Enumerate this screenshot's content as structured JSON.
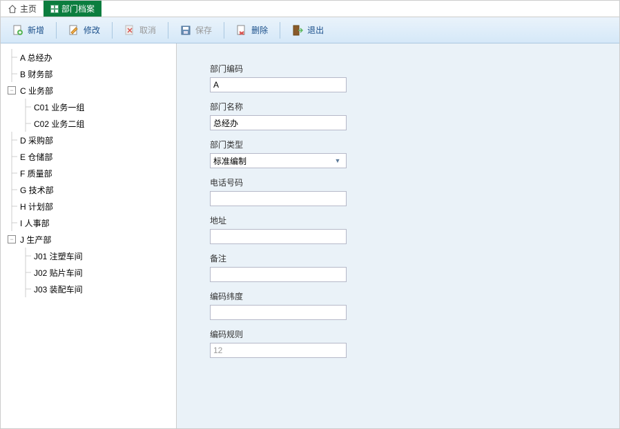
{
  "tabs": {
    "home": "主页",
    "active": "部门档案"
  },
  "toolbar": {
    "add": "新增",
    "edit": "修改",
    "cancel": "取消",
    "save": "保存",
    "delete": "删除",
    "exit": "退出"
  },
  "tree": [
    {
      "depth": 0,
      "expander": "",
      "code": "A",
      "name": "总经办"
    },
    {
      "depth": 0,
      "expander": "",
      "code": "B",
      "name": "财务部"
    },
    {
      "depth": 0,
      "expander": "-",
      "code": "C",
      "name": "业务部"
    },
    {
      "depth": 1,
      "expander": "",
      "code": "C01",
      "name": "业务一组"
    },
    {
      "depth": 1,
      "expander": "",
      "code": "C02",
      "name": "业务二组"
    },
    {
      "depth": 0,
      "expander": "",
      "code": "D",
      "name": "采购部"
    },
    {
      "depth": 0,
      "expander": "",
      "code": "E",
      "name": "仓储部"
    },
    {
      "depth": 0,
      "expander": "",
      "code": "F",
      "name": "质量部"
    },
    {
      "depth": 0,
      "expander": "",
      "code": "G",
      "name": "技术部"
    },
    {
      "depth": 0,
      "expander": "",
      "code": "H",
      "name": "计划部"
    },
    {
      "depth": 0,
      "expander": "",
      "code": "I",
      "name": "人事部"
    },
    {
      "depth": 0,
      "expander": "-",
      "code": "J",
      "name": "生产部"
    },
    {
      "depth": 1,
      "expander": "",
      "code": "J01",
      "name": "注塑车间"
    },
    {
      "depth": 1,
      "expander": "",
      "code": "J02",
      "name": "贴片车间"
    },
    {
      "depth": 1,
      "expander": "",
      "code": "J03",
      "name": "装配车间"
    }
  ],
  "form": {
    "labels": {
      "code": "部门编码",
      "name": "部门名称",
      "type": "部门类型",
      "phone": "电话号码",
      "addr": "地址",
      "remark": "备注",
      "dim": "编码纬度",
      "rule": "编码规则"
    },
    "values": {
      "code": "A",
      "name": "总经办",
      "type": "标准编制",
      "phone": "",
      "addr": "",
      "remark": "",
      "dim": "",
      "rule": "12"
    }
  }
}
